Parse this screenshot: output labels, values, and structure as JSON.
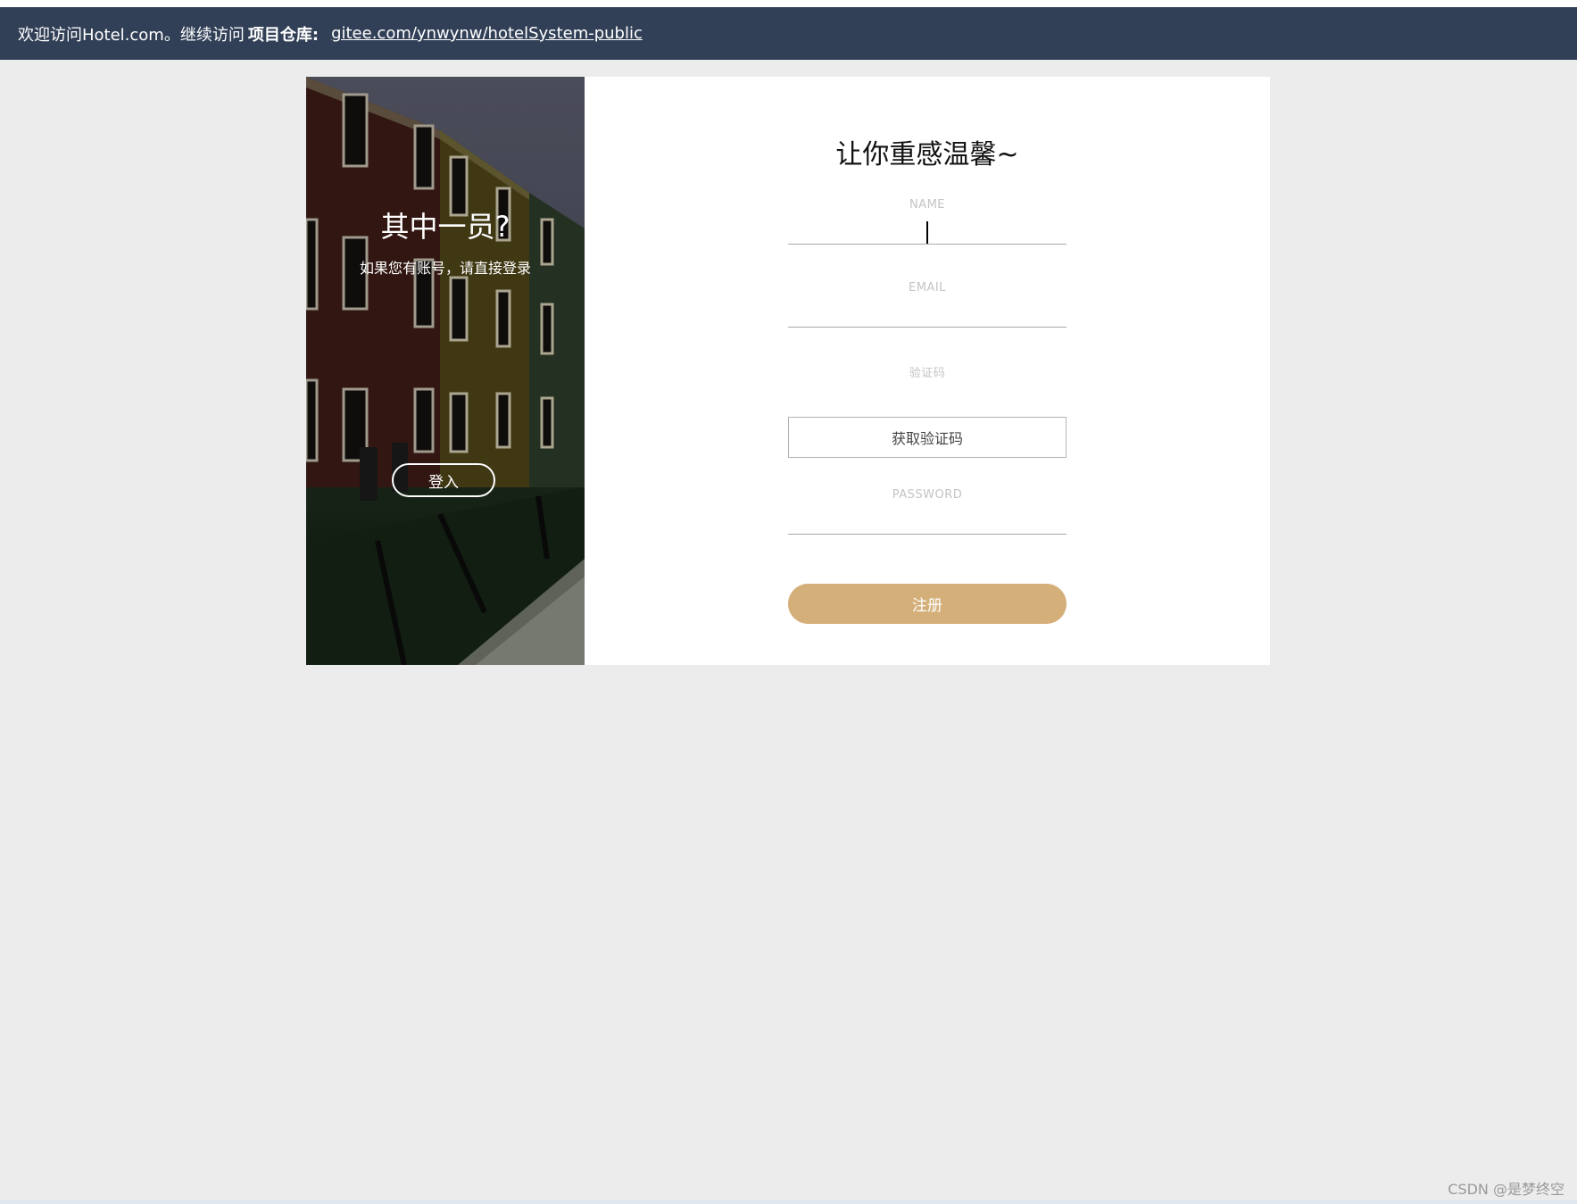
{
  "banner": {
    "welcome_text": "欢迎访问Hotel.com。继续访问",
    "repo_label": "项目仓库:",
    "repo_link": "gitee.com/ynwynw/hotelSystem-public"
  },
  "side": {
    "title": "其中一员?",
    "subtitle": "如果您有账号，请直接登录",
    "login_button": "登入"
  },
  "form": {
    "title": "让你重感温馨~",
    "name_label": "NAME",
    "name_value": "",
    "email_label": "EMAIL",
    "email_value": "",
    "code_label": "验证码",
    "code_value": "",
    "get_code_button": "获取验证码",
    "password_label": "PASSWORD",
    "password_value": "",
    "register_button": "注册"
  },
  "watermark": "CSDN @是梦终空",
  "colors": {
    "banner_bg": "#324057",
    "accent": "#d4af7a",
    "page_bg": "#ececec"
  }
}
